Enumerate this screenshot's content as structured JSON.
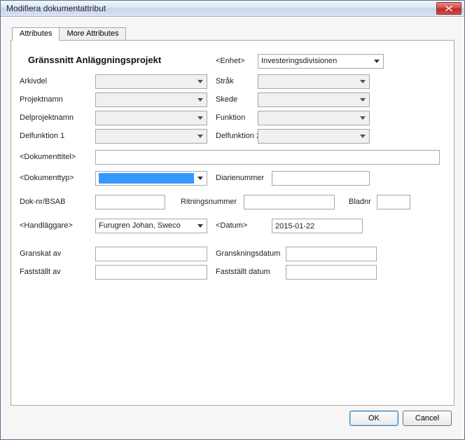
{
  "window": {
    "title": "Modifiera dokumentattribut",
    "ok": "OK",
    "cancel": "Cancel"
  },
  "tabs": {
    "attributes": "Attributes",
    "more": "More Attributes"
  },
  "heading": "Gränssnitt Anläggningsprojekt",
  "labels": {
    "enhet": "<Enhet>",
    "arkivdel": "Arkivdel",
    "strak": "Stråk",
    "projektnamn": "Projektnamn",
    "skede": "Skede",
    "delprojektnamn": "Delprojektnamn",
    "funktion": "Funktion",
    "delfunktion1": "Delfunktion 1",
    "delfunktion2": "Delfunktion 2",
    "dokumenttitel": "<Dokumenttitel>",
    "dokumenttyp": "<Dokumenttyp>",
    "diarienummer": "Diarienummer",
    "doknr": "Dok-nr/BSAB",
    "ritningsnummer": "Ritningsnummer",
    "bladnr": "Bladnr",
    "handlaggare": "<Handläggare>",
    "datum": "<Datum>",
    "granskatav": "Granskat av",
    "granskningsdatum": "Granskningsdatum",
    "faststallav": "Fastställt av",
    "faststalldatum": "Fastställt datum"
  },
  "values": {
    "enhet": "Investeringsdivisionen",
    "arkivdel": "",
    "strak": "",
    "projektnamn": "",
    "skede": "",
    "delprojektnamn": "",
    "funktion": "",
    "delfunktion1": "",
    "delfunktion2": "",
    "dokumenttitel": "",
    "dokumenttyp": "",
    "diarienummer": "",
    "doknr": "",
    "ritningsnummer": "",
    "bladnr": "",
    "handlaggare": "Furugren Johan, Sweco",
    "datum": "2015-01-22",
    "granskatav": "",
    "granskningsdatum": "",
    "faststallav": "",
    "faststalldatum": ""
  }
}
